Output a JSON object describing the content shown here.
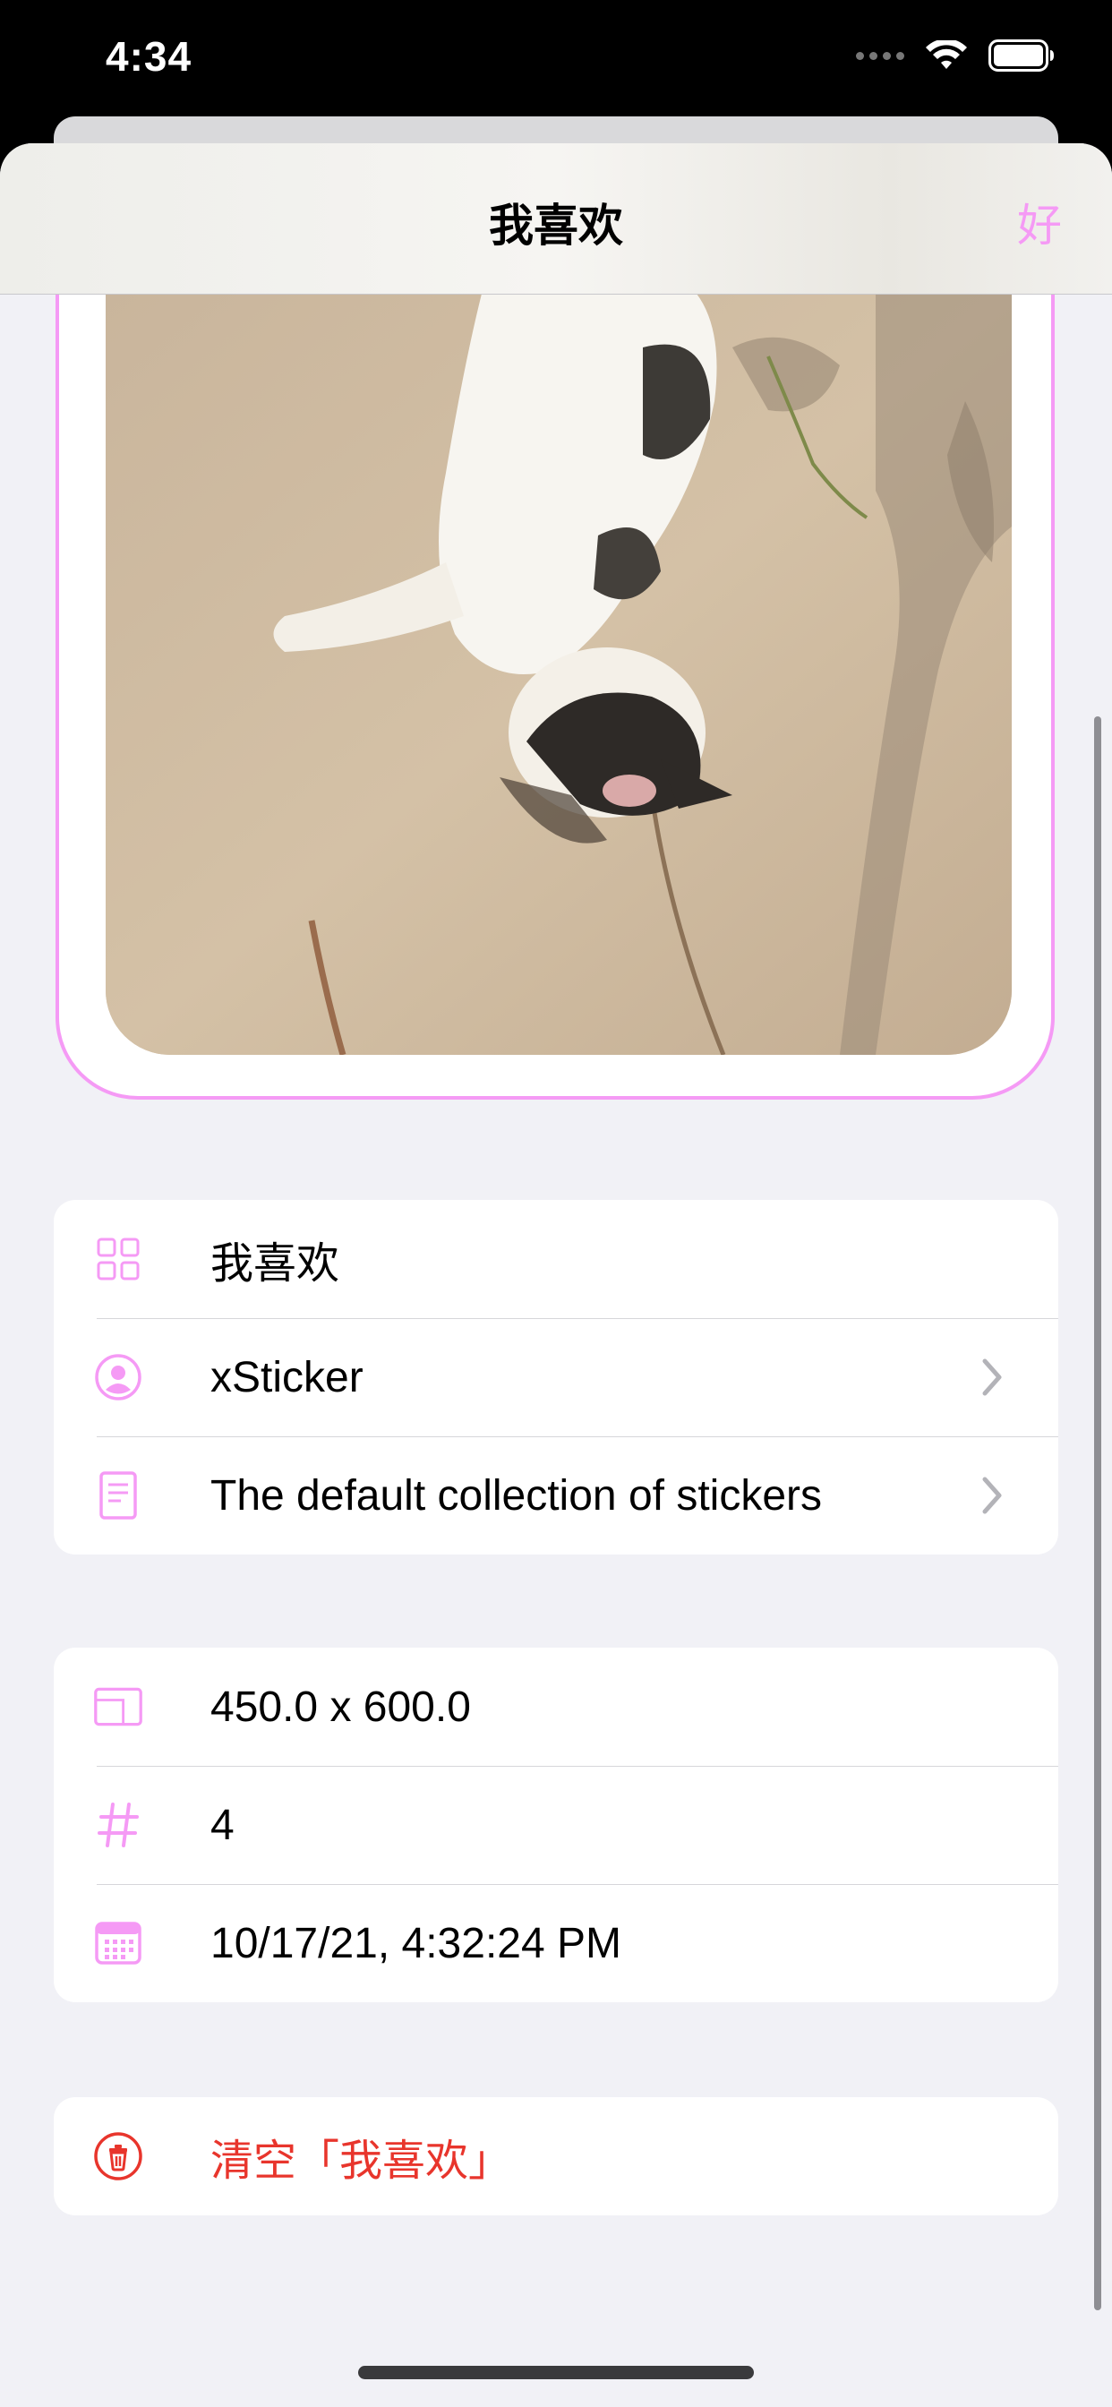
{
  "status_bar": {
    "time": "4:34"
  },
  "nav": {
    "title": "我喜欢",
    "done_label": "好"
  },
  "colors": {
    "accent": "#f59af5",
    "danger": "#e8352c",
    "background": "#f1f1f6"
  },
  "collection_group": {
    "rows": [
      {
        "icon": "grid-icon",
        "label": "我喜欢",
        "chevron": false
      },
      {
        "icon": "person-circle-icon",
        "label": "xSticker",
        "chevron": true
      },
      {
        "icon": "document-icon",
        "label": "The default collection of stickers",
        "chevron": true
      }
    ]
  },
  "info_group": {
    "rows": [
      {
        "icon": "dimensions-icon",
        "label": "450.0 x 600.0"
      },
      {
        "icon": "number-icon",
        "label": "4"
      },
      {
        "icon": "calendar-icon",
        "label": "10/17/21, 4:32:24 PM"
      }
    ]
  },
  "action_group": {
    "clear_label": "清空「我喜欢」",
    "icon": "trash-circle-icon"
  }
}
